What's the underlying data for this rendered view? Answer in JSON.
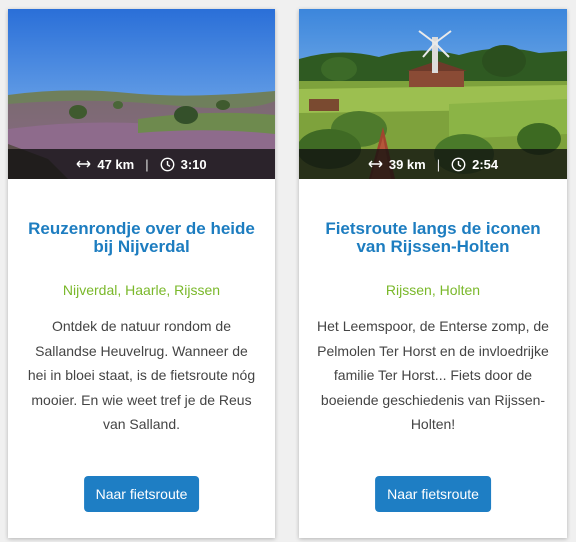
{
  "colors": {
    "title": "#1d7dc0",
    "places": "#7ab82a",
    "button": "#1e7ec4"
  },
  "cards": [
    {
      "distance": "47 km",
      "duration": "3:10",
      "title": "Reuzenrondje over de heide bij Nijverdal",
      "places": "Nijverdal, Haarle, Rijssen",
      "description": "Ontdek de natuur rondom de Sallandse Heuvelrug. Wanneer de hei in bloei staat, is de fietsroute nóg mooier. En wie weet tref je de Reus van Salland.",
      "button": "Naar fietsroute"
    },
    {
      "distance": "39 km",
      "duration": "2:54",
      "title": "Fietsroute langs de iconen van Rijssen-Holten",
      "places": "Rijssen, Holten",
      "description": "Het Leemspoor, de Enterse zomp, de Pelmolen Ter Horst en de invloedrijke familie Ter Horst... Fiets door de boeiende geschiedenis van Rijssen-Holten!",
      "button": "Naar fietsroute"
    }
  ],
  "icons": {
    "distance": "arrows-horizontal-icon",
    "duration": "clock-icon"
  }
}
